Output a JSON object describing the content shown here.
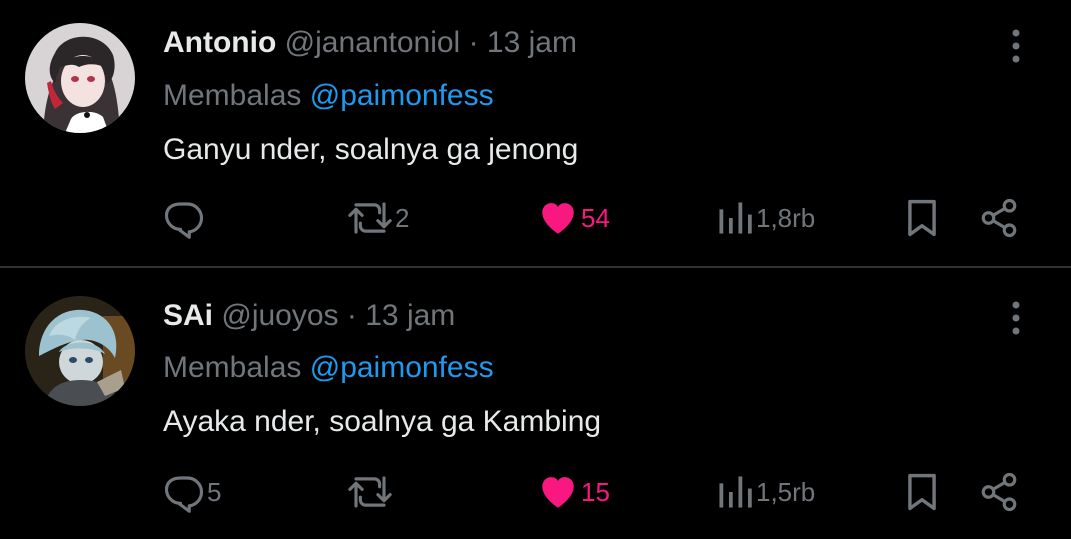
{
  "colors": {
    "background": "#000000",
    "text_primary": "#e7e9ea",
    "text_secondary": "#71767b",
    "link": "#1d9bf0",
    "like": "#f91880",
    "divider": "#2f3336"
  },
  "tweets": [
    {
      "name": "Antonio",
      "handle": "@janantoniol",
      "separator": "·",
      "time": "13 jam",
      "reply_prefix": "Membalas",
      "reply_to": "@paimonfess",
      "text": "Ganyu nder, soalnya ga jenong",
      "replies": "",
      "retweets": "2",
      "likes": "54",
      "views": "1,8rb",
      "liked": true
    },
    {
      "name": "SAi",
      "handle": "@juoyos",
      "separator": "·",
      "time": "13 jam",
      "reply_prefix": "Membalas",
      "reply_to": "@paimonfess",
      "text": "Ayaka nder, soalnya ga Kambing",
      "replies": "5",
      "retweets": "",
      "likes": "15",
      "views": "1,5rb",
      "liked": true
    }
  ],
  "icons": {
    "reply": "reply-icon",
    "retweet": "retweet-icon",
    "like": "heart-icon",
    "views": "views-icon",
    "bookmark": "bookmark-icon",
    "share": "share-icon",
    "more": "more-icon",
    "avatar": "avatar"
  }
}
